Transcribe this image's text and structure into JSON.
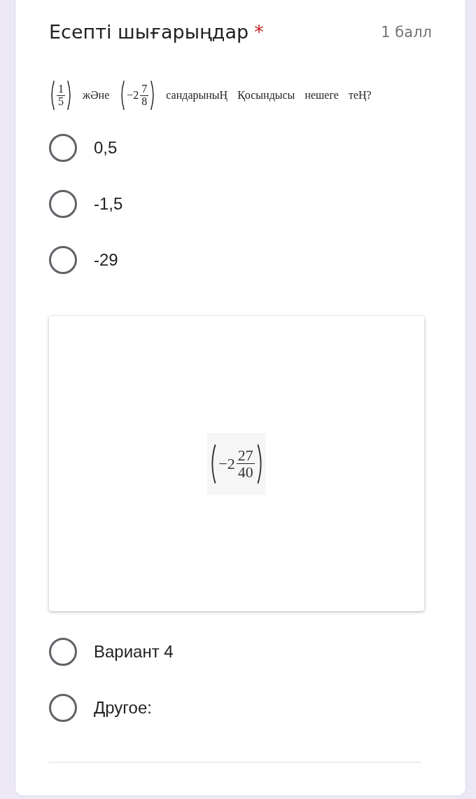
{
  "question": {
    "title": "Есепті шығарыңдар",
    "required_mark": "*",
    "points": "1 балл",
    "prompt": [
      {
        "kind": "fraction",
        "numerator": "1",
        "denominator": "5"
      },
      {
        "kind": "text",
        "text": "жӘне"
      },
      {
        "kind": "fraction",
        "whole": "−2",
        "numerator": "7",
        "denominator": "8"
      },
      {
        "kind": "text",
        "text": "сандарыныҢ"
      },
      {
        "kind": "text",
        "text": "Қосындысы"
      },
      {
        "kind": "text",
        "text": "нешеге"
      },
      {
        "kind": "text",
        "text": "теҢ?"
      }
    ],
    "options": [
      {
        "kind": "text",
        "label": "0,5",
        "selected": false
      },
      {
        "kind": "text",
        "label": "-1,5",
        "selected": false
      },
      {
        "kind": "text",
        "label": "-29",
        "selected": false
      },
      {
        "kind": "image",
        "image": {
          "whole": "−2",
          "numerator": "27",
          "denominator": "40"
        }
      },
      {
        "kind": "text",
        "label": "Вариант 4",
        "selected": false
      },
      {
        "kind": "other",
        "label": "Другое:",
        "selected": false
      }
    ]
  }
}
